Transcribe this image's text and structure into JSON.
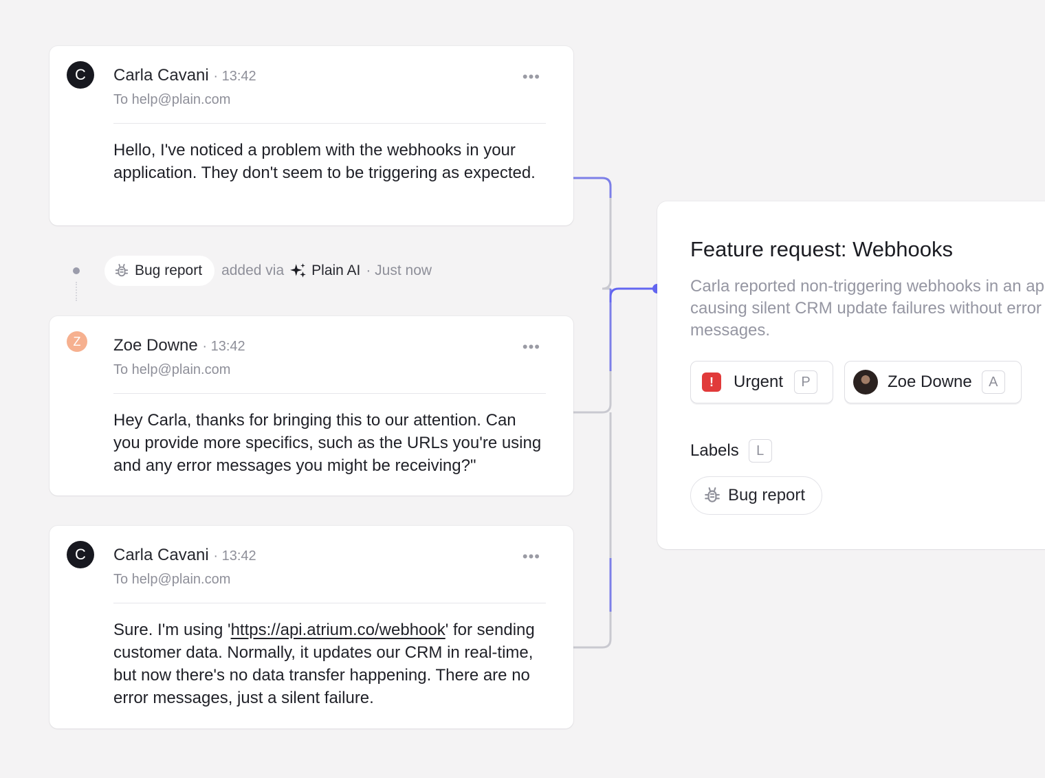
{
  "messages": [
    {
      "avatar_letter": "C",
      "author": "Carla Cavani",
      "time": "· 13:42",
      "to": "To help@plain.com",
      "more": "•••",
      "body": "Hello, I've noticed a problem with the webhooks in your application. They don't seem to be triggering as expected."
    },
    {
      "avatar_letter": "Z",
      "author": "Zoe Downe",
      "time": "· 13:42",
      "to": "To help@plain.com",
      "more": "•••",
      "body": "Hey Carla, thanks for bringing this to our attention. Can you provide more specifics, such as the URLs you're using and any error messages you might be receiving?\""
    },
    {
      "avatar_letter": "C",
      "author": "Carla Cavani",
      "time": "· 13:42",
      "to": "To help@plain.com",
      "more": "•••",
      "body_before": "Sure. I'm using '",
      "body_link": "https://api.atrium.co/webhook",
      "body_after": "' for sending customer data. Normally, it updates our CRM in real-time, but now there's no data transfer happening. There are no error messages, just a silent failure."
    }
  ],
  "event": {
    "label": "Bug report",
    "added_via": "added via",
    "source": "Plain AI",
    "when": "· Just now"
  },
  "panel": {
    "title": "Feature request: Webhooks",
    "description": "Carla reported non-triggering webhooks in an app, causing silent CRM update failures without error messages.",
    "priority": {
      "label": "Urgent",
      "shortcut": "P",
      "icon": "exclamation-icon"
    },
    "assignee": {
      "label": "Zoe Downe",
      "shortcut": "A"
    },
    "labels_title": "Labels",
    "labels_shortcut": "L",
    "labels": [
      "Bug report"
    ]
  },
  "colors": {
    "accent": "#6366f1",
    "urgent": "#e13a3a",
    "background": "#f4f3f4"
  }
}
